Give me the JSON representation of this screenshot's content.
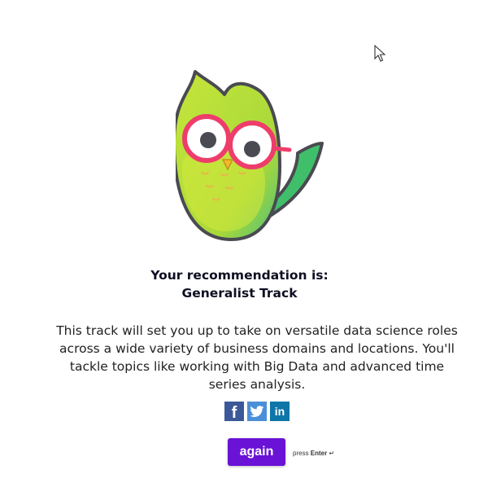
{
  "result": {
    "heading": "Your recommendation is:",
    "track_name": "Generalist Track",
    "description": "This track will set you up to take on versatile data science roles across a wide variety of business domains and locations. You'll tackle topics like working with Big Data and advanced time series analysis."
  },
  "social": {
    "icons": [
      "facebook-icon",
      "twitter-icon",
      "linkedin-icon"
    ],
    "facebook_color": "#3b5998",
    "twitter_color": "#4a90d9",
    "linkedin_color": "#0e76a8"
  },
  "actions": {
    "again_label": "again",
    "press_text": "press",
    "enter_key": "Enter",
    "enter_symbol": "↵",
    "button_color": "#6a12d6"
  }
}
